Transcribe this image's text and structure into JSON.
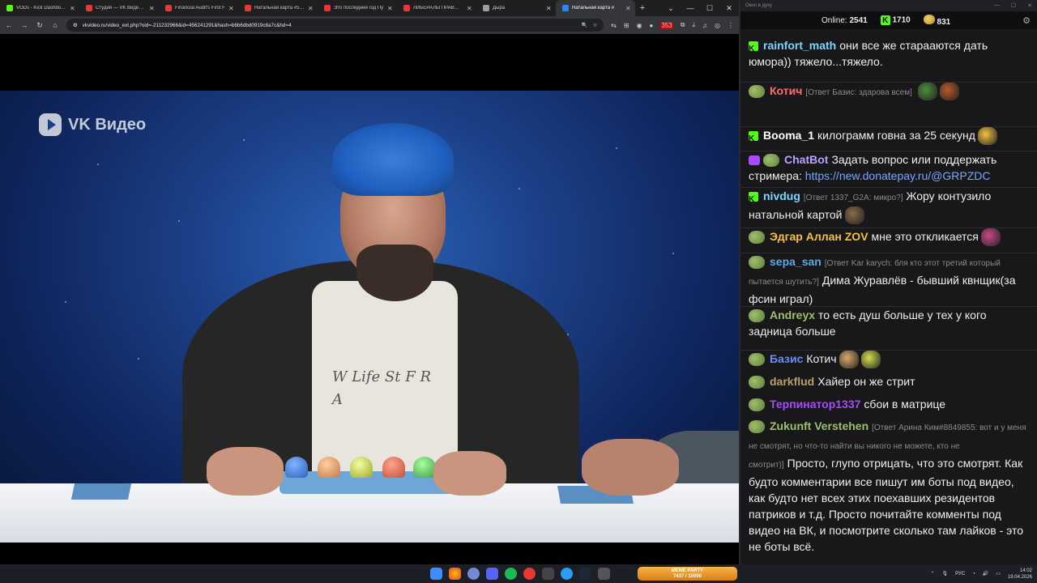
{
  "browser": {
    "tabs": [
      {
        "title": "VODs - Kick Dashboard",
        "color": "#53fc18",
        "active": false
      },
      {
        "title": "Студия — VK Видео Ли",
        "color": "#e53935",
        "active": false
      },
      {
        "title": "Financial Audit's First F",
        "color": "#e53935",
        "active": false
      },
      {
        "title": "Натальная карта #58 Л",
        "color": "#e53935",
        "active": false
      },
      {
        "title": "Это последний год Пу",
        "color": "#e53935",
        "active": false
      },
      {
        "title": "ЛИБЕРАЛЫ ПРАВЫ В В",
        "color": "#e53935",
        "active": false
      },
      {
        "title": "Дыра",
        "color": "#9aa0a6",
        "active": false
      },
      {
        "title": "Натальная карта #",
        "color": "#2787f5",
        "active": true
      }
    ],
    "url": "vkvideo.ru/video_ext.php?oid=-211232966&id=456241291&hash=b6b6dbd0919c8a7c&hd=4",
    "ext_badge": "353"
  },
  "video": {
    "watermark": "VK Видео",
    "shirt_print": "W Life St F R A"
  },
  "chat": {
    "window_title": "Окно в духу",
    "online_label": "Online:",
    "online_count": "2541",
    "kick_count": "1710",
    "twitch_count": "831",
    "messages": [
      {
        "user": "rainfort_math",
        "user_color": "#7fd3ff",
        "platform": "kick",
        "reply": "",
        "text": "они все же старааются дать юмора)) тяжело...тяжело."
      },
      {
        "user": "Котич",
        "user_color": "#ff6b6b",
        "platform": "twitch",
        "reply": "[Ответ Базис: здарова всем]",
        "text": ""
      },
      {
        "user": "Booma_1",
        "user_color": "#ffffff",
        "platform": "kick",
        "reply": "",
        "text": "килограмм говна за 25 секунд"
      },
      {
        "user": "ChatBot",
        "user_color": "#b9a3ff",
        "platform": "twitch",
        "reply": "",
        "text": "Задать вопрос или поддержать стримера:",
        "link": "https://new.donatepay.ru/@GRPZDC"
      },
      {
        "user": "nivdug",
        "user_color": "#7fd3ff",
        "platform": "kick",
        "reply": "[Ответ 1337_G2A: микро?]",
        "text": "Жору контузило натальной картой"
      },
      {
        "user": "Эдгар Аллан ZOV",
        "user_color": "#f5c242",
        "platform": "twitch",
        "reply": "",
        "text": "мне это откликается"
      },
      {
        "user": "sepa_san",
        "user_color": "#5aa9e6",
        "platform": "twitch",
        "reply": "[Ответ Kar karych: бля кто этот третий который пытается шутить?]",
        "text": "Дима Журавлёв - бывший квнщик(за фсин играл)"
      },
      {
        "user": "Andreyx",
        "user_color": "#9fbf6a",
        "platform": "twitch",
        "reply": "",
        "text": "то есть душ больше у тех у кого задница больше"
      },
      {
        "user": "Базис",
        "user_color": "#6a8cff",
        "platform": "twitch",
        "reply": "",
        "text": "Котич"
      },
      {
        "user": "darkflud",
        "user_color": "#b9a06a",
        "platform": "twitch",
        "reply": "",
        "text": "Хайер он же стрит"
      },
      {
        "user": "Терпинатор1337",
        "user_color": "#a64bff",
        "platform": "twitch",
        "reply": "",
        "text": "сбои в матрице"
      },
      {
        "user": "Zukunft Verstehen",
        "user_color": "#9fbf6a",
        "platform": "twitch",
        "reply": "[Ответ Арина Ким#8849855: вот и у меня не смотрят, но что-то найти вы никого не можете, кто не смотрит)]",
        "text": "Просто, глупо отрицать, что это смотрят. Как будто комментарии все пишут им боты под видео, как будто нет всех этих поехавших резидентов патриков и т.д. Просто почитайте комменты под видео на ВК, и посмотрите сколько там лайков - это не боты всё."
      }
    ]
  },
  "taskbar": {
    "widget_title": "MEME PARTY",
    "widget_progress": "7437 / 15000",
    "lang": "РУС",
    "time": "14:02",
    "date": "19.04.2026"
  }
}
